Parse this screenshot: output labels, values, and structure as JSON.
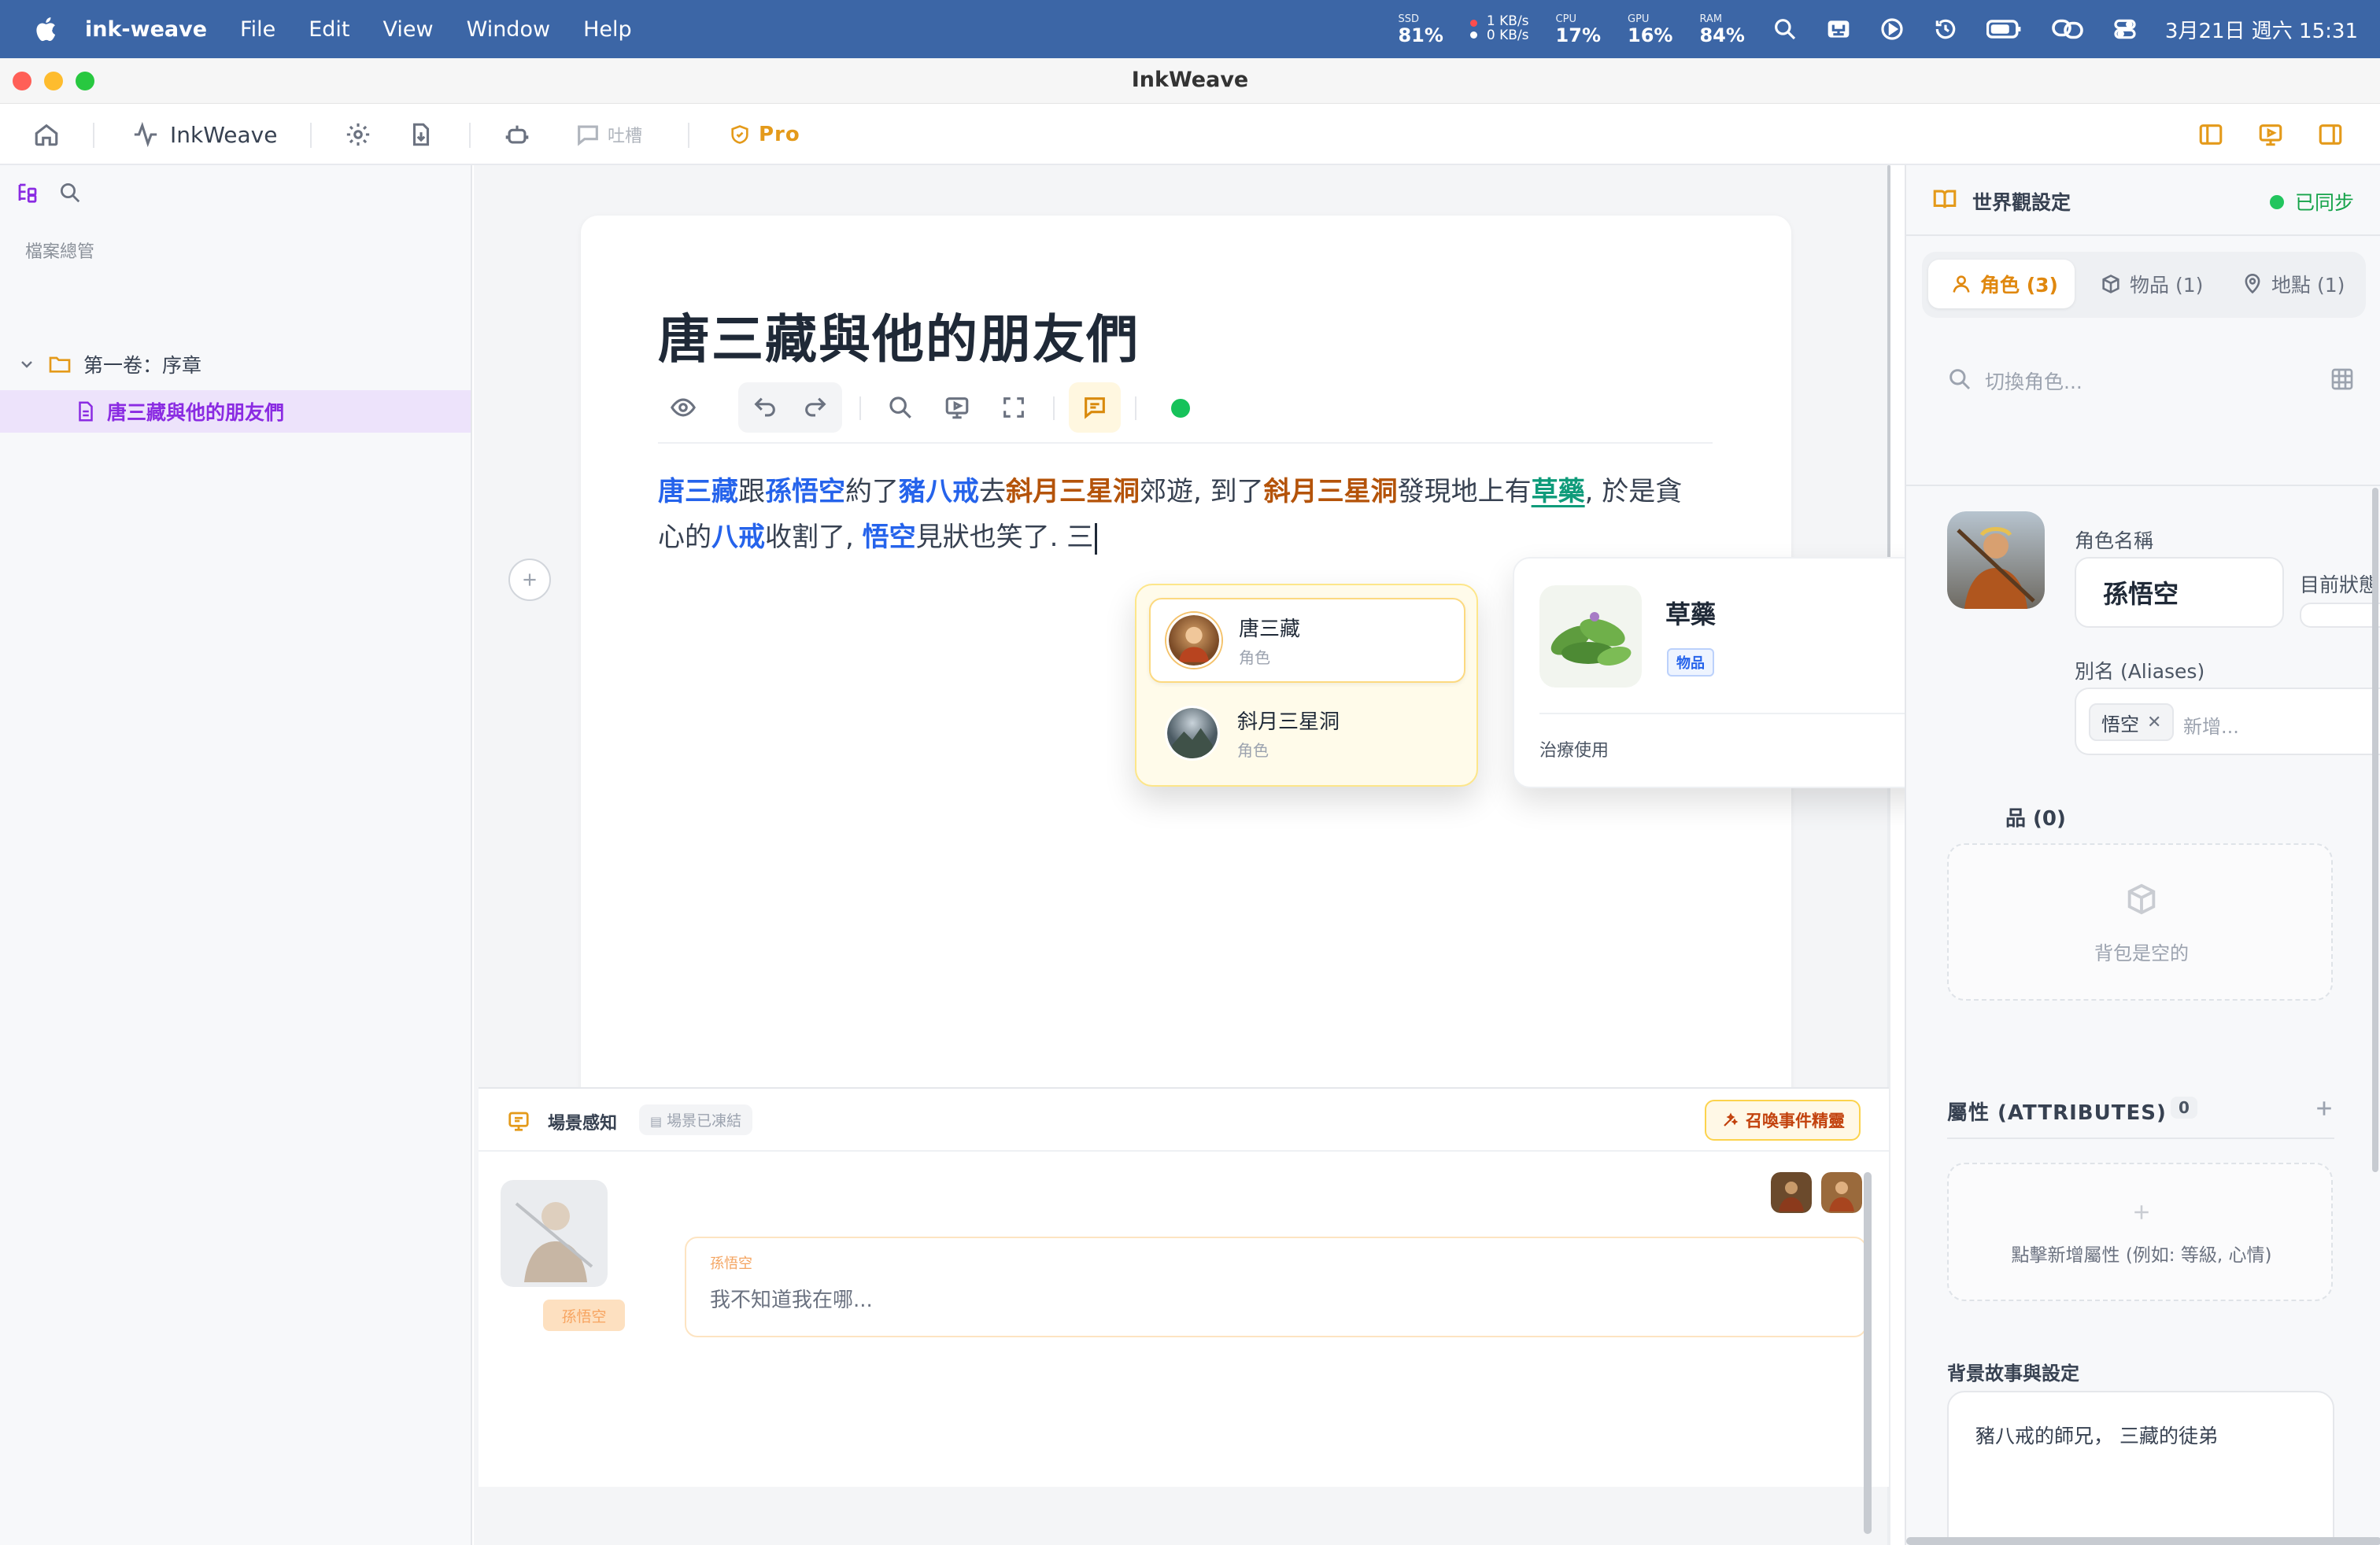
{
  "menubar": {
    "app_name": "ink-weave",
    "menus": [
      "File",
      "Edit",
      "View",
      "Window",
      "Help"
    ],
    "stats": {
      "ssd_label": "SSD",
      "ssd_value": "81%",
      "net_up": "1 KB/s",
      "net_down": "0 KB/s",
      "cpu_label": "CPU",
      "cpu_value": "17%",
      "gpu_label": "GPU",
      "gpu_value": "16%",
      "ram_label": "RAM",
      "ram_value": "84%"
    },
    "datetime": "3月21日 週六  15:31"
  },
  "window": {
    "title": "InkWeave"
  },
  "toolbar": {
    "app_label": "InkWeave",
    "feedback_label": "吐槽",
    "pro_label": "Pro"
  },
  "sidebar": {
    "section_title": "檔案總管",
    "folder": "第一卷：序章",
    "file": "唐三藏與他的朋友們"
  },
  "editor": {
    "title": "唐三藏與他的朋友們",
    "body_segments": [
      {
        "text": "唐三藏",
        "kind": "char"
      },
      {
        "text": "跟",
        "kind": "plain"
      },
      {
        "text": "孫悟空",
        "kind": "char"
      },
      {
        "text": "約了",
        "kind": "plain"
      },
      {
        "text": "豬八戒",
        "kind": "char"
      },
      {
        "text": "去",
        "kind": "plain"
      },
      {
        "text": "斜月三星洞",
        "kind": "loc"
      },
      {
        "text": "郊遊, 到了",
        "kind": "plain"
      },
      {
        "text": "斜月三星洞",
        "kind": "loc"
      },
      {
        "text": "發現地上有",
        "kind": "plain"
      },
      {
        "text": "草藥",
        "kind": "item"
      },
      {
        "text": ", 於是貪心的",
        "kind": "plain"
      },
      {
        "text": "八戒",
        "kind": "char"
      },
      {
        "text": "收割了, ",
        "kind": "plain"
      },
      {
        "text": "悟空",
        "kind": "char"
      },
      {
        "text": "見狀也笑了. 三",
        "kind": "plain"
      }
    ]
  },
  "mention_popup": {
    "items": [
      {
        "name": "唐三藏",
        "type": "角色"
      },
      {
        "name": "斜月三星洞",
        "type": "角色"
      }
    ]
  },
  "item_card": {
    "name": "草藥",
    "badge": "物品",
    "description": "治療使用"
  },
  "scene": {
    "title": "場景感知",
    "status": "場景已凍結",
    "summon_label": "召喚事件精靈",
    "character_tag": "孫悟空",
    "speaker": "孫悟空",
    "message": "我不知道我在哪..."
  },
  "right_panel": {
    "header": "世界觀設定",
    "sync_status": "已同步",
    "tabs": [
      {
        "label": "角色 (3)"
      },
      {
        "label": "物品 (1)"
      },
      {
        "label": "地點 (1)"
      }
    ],
    "search_placeholder": "切換角色...",
    "name_label": "角色名稱",
    "name_value": "孫悟空",
    "status_label": "目前狀態",
    "aliases_label": "別名 (Aliases)",
    "alias_chip": "悟空",
    "alias_placeholder": "新增...",
    "inventory_label": "品 (0)",
    "inventory_empty": "背包是空的",
    "attributes_label": "屬性 (ATTRIBUTES)",
    "attributes_count": "0",
    "attributes_hint": "點擊新增屬性 (例如: 等級, 心情)",
    "backstory_label": "背景故事與設定",
    "backstory_text": "豬八戒的師兄， 三藏的徒弟"
  },
  "colors": {
    "menubar_bg": "#3c66a6",
    "accent_orange": "#e49a1a",
    "character_blue": "#2563eb",
    "location_brown": "#b45309",
    "item_green": "#0f9b7a",
    "sidebar_active": "#8a2be2",
    "sync_green": "#22c55e"
  },
  "icons": [
    "apple-icon",
    "home-icon",
    "activity-icon",
    "gear-icon",
    "download-icon",
    "robot-icon",
    "comment-icon",
    "shield-icon",
    "sidebar-left-icon",
    "preview-icon",
    "sidebar-right-icon",
    "tree-icon",
    "search-icon",
    "folder-icon",
    "file-icon",
    "eye-icon",
    "undo-icon",
    "redo-icon",
    "fullscreen-icon",
    "chat-icon",
    "book-icon",
    "user-icon",
    "box-icon",
    "map-pin-icon",
    "grid-icon",
    "plus-icon"
  ]
}
